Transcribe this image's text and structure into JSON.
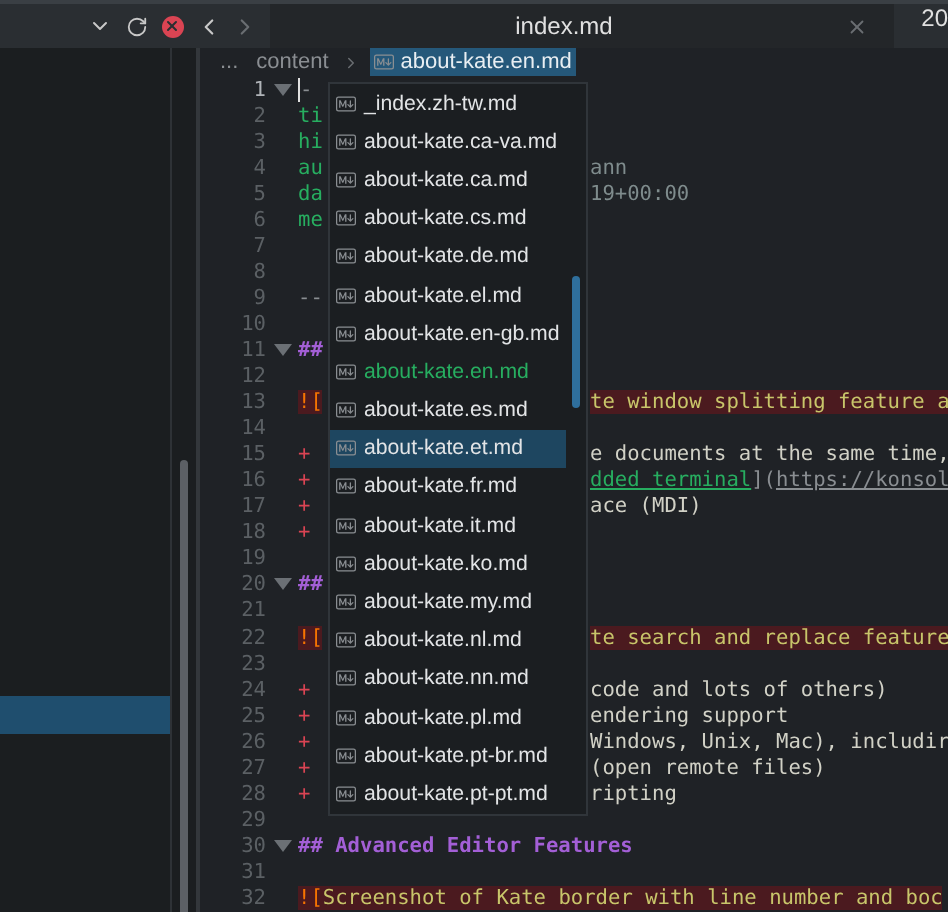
{
  "tab": {
    "title": "index.md",
    "next_tab": "20"
  },
  "breadcrumb": {
    "more": "...",
    "items": [
      {
        "label": "content",
        "selected": false
      },
      {
        "label": "about-kate.en.md",
        "selected": true
      }
    ]
  },
  "sidebar": {
    "rows": [
      {
        "selected": true
      }
    ]
  },
  "lines": [
    {
      "number": "1",
      "fold": true,
      "current": true,
      "left": [
        {
          "text": "-",
          "kind": "fence"
        }
      ]
    },
    {
      "number": "2",
      "fold": false,
      "current": false,
      "left": [
        {
          "text": "ti",
          "kind": "key"
        }
      ]
    },
    {
      "number": "3",
      "fold": false,
      "current": false,
      "left": [
        {
          "text": "hi",
          "kind": "key"
        }
      ]
    },
    {
      "number": "4",
      "fold": false,
      "current": false,
      "left": [
        {
          "text": "au",
          "kind": "key"
        }
      ],
      "right": [
        {
          "text": "ann",
          "kind": "meta"
        }
      ]
    },
    {
      "number": "5",
      "fold": false,
      "current": false,
      "left": [
        {
          "text": "da",
          "kind": "key"
        }
      ],
      "right": [
        {
          "text": "19+00:00",
          "kind": "meta"
        }
      ]
    },
    {
      "number": "6",
      "fold": false,
      "current": false,
      "left": [
        {
          "text": "me",
          "kind": "key"
        }
      ]
    },
    {
      "number": "7",
      "fold": false,
      "current": false
    },
    {
      "number": "8",
      "fold": false,
      "current": false
    },
    {
      "number": "9",
      "fold": false,
      "current": false,
      "left": [
        {
          "text": "--",
          "kind": "fence"
        }
      ]
    },
    {
      "number": "10",
      "fold": false,
      "current": false
    },
    {
      "number": "11",
      "fold": true,
      "current": false,
      "left": [
        {
          "text": "##",
          "kind": "heading"
        }
      ]
    },
    {
      "number": "12",
      "fold": false,
      "current": false
    },
    {
      "number": "13",
      "fold": false,
      "current": false,
      "left": [
        {
          "text": "![",
          "kind": "image"
        }
      ],
      "right": [
        {
          "text": "te window splitting feature a",
          "kind": "alt"
        }
      ]
    },
    {
      "number": "14",
      "fold": false,
      "current": false
    },
    {
      "number": "15",
      "fold": false,
      "current": false,
      "left": [
        {
          "text": "+",
          "kind": "bullet"
        }
      ],
      "right": [
        {
          "text": "e documents at the same time,",
          "kind": "text"
        }
      ]
    },
    {
      "number": "16",
      "fold": false,
      "current": false,
      "left": [
        {
          "text": "+",
          "kind": "bullet"
        }
      ],
      "right": [
        {
          "text": "dded terminal",
          "kind": "link"
        },
        {
          "text": "](",
          "kind": "punct"
        },
        {
          "text": "https://konsol",
          "kind": "url"
        }
      ]
    },
    {
      "number": "17",
      "fold": false,
      "current": false,
      "left": [
        {
          "text": "+",
          "kind": "bullet"
        }
      ],
      "right": [
        {
          "text": "ace (MDI)",
          "kind": "text"
        }
      ]
    },
    {
      "number": "18",
      "fold": false,
      "current": false,
      "left": [
        {
          "text": "+",
          "kind": "bullet"
        }
      ]
    },
    {
      "number": "19",
      "fold": false,
      "current": false
    },
    {
      "number": "20",
      "fold": true,
      "current": false,
      "left": [
        {
          "text": "##",
          "kind": "heading"
        }
      ]
    },
    {
      "number": "21",
      "fold": false,
      "current": false
    },
    {
      "number": "22",
      "fold": false,
      "current": false,
      "left": [
        {
          "text": "![",
          "kind": "image"
        }
      ],
      "right": [
        {
          "text": "te search and replace feature",
          "kind": "alt"
        }
      ]
    },
    {
      "number": "23",
      "fold": false,
      "current": false
    },
    {
      "number": "24",
      "fold": false,
      "current": false,
      "left": [
        {
          "text": "+",
          "kind": "bullet"
        }
      ],
      "right": [
        {
          "text": "code and lots of others)",
          "kind": "text"
        }
      ]
    },
    {
      "number": "25",
      "fold": false,
      "current": false,
      "left": [
        {
          "text": "+",
          "kind": "bullet"
        }
      ],
      "right": [
        {
          "text": "endering support",
          "kind": "text"
        }
      ]
    },
    {
      "number": "26",
      "fold": false,
      "current": false,
      "left": [
        {
          "text": "+",
          "kind": "bullet"
        }
      ],
      "right": [
        {
          "text": "Windows, Unix, Mac), includir",
          "kind": "text"
        }
      ]
    },
    {
      "number": "27",
      "fold": false,
      "current": false,
      "left": [
        {
          "text": "+",
          "kind": "bullet"
        }
      ],
      "right": [
        {
          "text": "(open remote files)",
          "kind": "text"
        }
      ]
    },
    {
      "number": "28",
      "fold": false,
      "current": false,
      "left": [
        {
          "text": "+",
          "kind": "bullet"
        }
      ],
      "right": [
        {
          "text": "ripting",
          "kind": "text"
        }
      ]
    },
    {
      "number": "29",
      "fold": false,
      "current": false
    },
    {
      "number": "30",
      "fold": true,
      "current": false,
      "left": [
        {
          "text": "## Advanced Editor Features",
          "kind": "heading"
        }
      ]
    },
    {
      "number": "31",
      "fold": false,
      "current": false
    },
    {
      "number": "32",
      "fold": false,
      "current": false,
      "left": [
        {
          "text": "![",
          "kind": "image"
        },
        {
          "text": "Screenshot of Kate border with line number and boc",
          "kind": "alt"
        }
      ]
    }
  ],
  "completion": {
    "items": [
      {
        "label": "_index.zh-tw.md",
        "selected": false,
        "current": false
      },
      {
        "label": "about-kate.ca-va.md",
        "selected": false,
        "current": false
      },
      {
        "label": "about-kate.ca.md",
        "selected": false,
        "current": false
      },
      {
        "label": "about-kate.cs.md",
        "selected": false,
        "current": false
      },
      {
        "label": "about-kate.de.md",
        "selected": false,
        "current": false
      },
      {
        "label": "about-kate.el.md",
        "selected": false,
        "current": false
      },
      {
        "label": "about-kate.en-gb.md",
        "selected": false,
        "current": false
      },
      {
        "label": "about-kate.en.md",
        "selected": false,
        "current": true
      },
      {
        "label": "about-kate.es.md",
        "selected": false,
        "current": false
      },
      {
        "label": "about-kate.et.md",
        "selected": true,
        "current": false
      },
      {
        "label": "about-kate.fr.md",
        "selected": false,
        "current": false
      },
      {
        "label": "about-kate.it.md",
        "selected": false,
        "current": false
      },
      {
        "label": "about-kate.ko.md",
        "selected": false,
        "current": false
      },
      {
        "label": "about-kate.my.md",
        "selected": false,
        "current": false
      },
      {
        "label": "about-kate.nl.md",
        "selected": false,
        "current": false
      },
      {
        "label": "about-kate.nn.md",
        "selected": false,
        "current": false
      },
      {
        "label": "about-kate.pl.md",
        "selected": false,
        "current": false
      },
      {
        "label": "about-kate.pt-br.md",
        "selected": false,
        "current": false
      },
      {
        "label": "about-kate.pt-pt.md",
        "selected": false,
        "current": false
      }
    ]
  }
}
